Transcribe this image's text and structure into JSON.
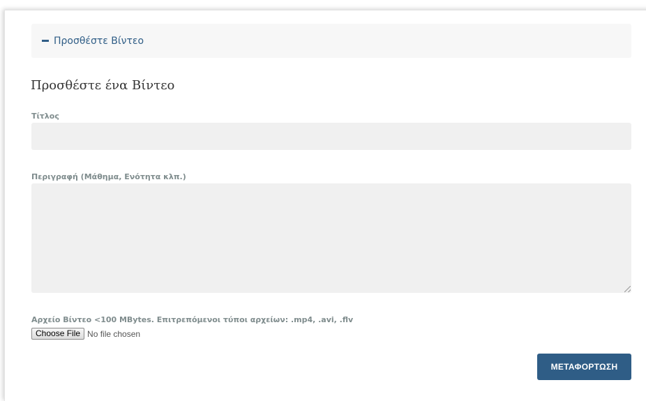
{
  "panel": {
    "toggle_icon": "minus-icon",
    "title": "Προσθέστε Βίντεο"
  },
  "form": {
    "heading": "Προσθέστε ένα Βίντεο",
    "title_label": "Τίτλος",
    "title_value": "",
    "description_label": "Περιγραφή (Μάθημα, Ενότητα κλπ.)",
    "description_value": "",
    "file_label": "Αρχείο Βίντεο <100 MBytes. Επιτρεπόμενοι τύποι αρχείων: .mp4, .avi, .flv",
    "choose_file_label": "Choose File",
    "file_status": "No file chosen",
    "submit_label": "ΜΕΤΑΦΟΡΤΩΣΗ"
  },
  "colors": {
    "accent": "#2f5d86",
    "label": "#7f8c8d",
    "input_bg": "#f0f0f0",
    "panel_bg": "#f7f7f7"
  }
}
